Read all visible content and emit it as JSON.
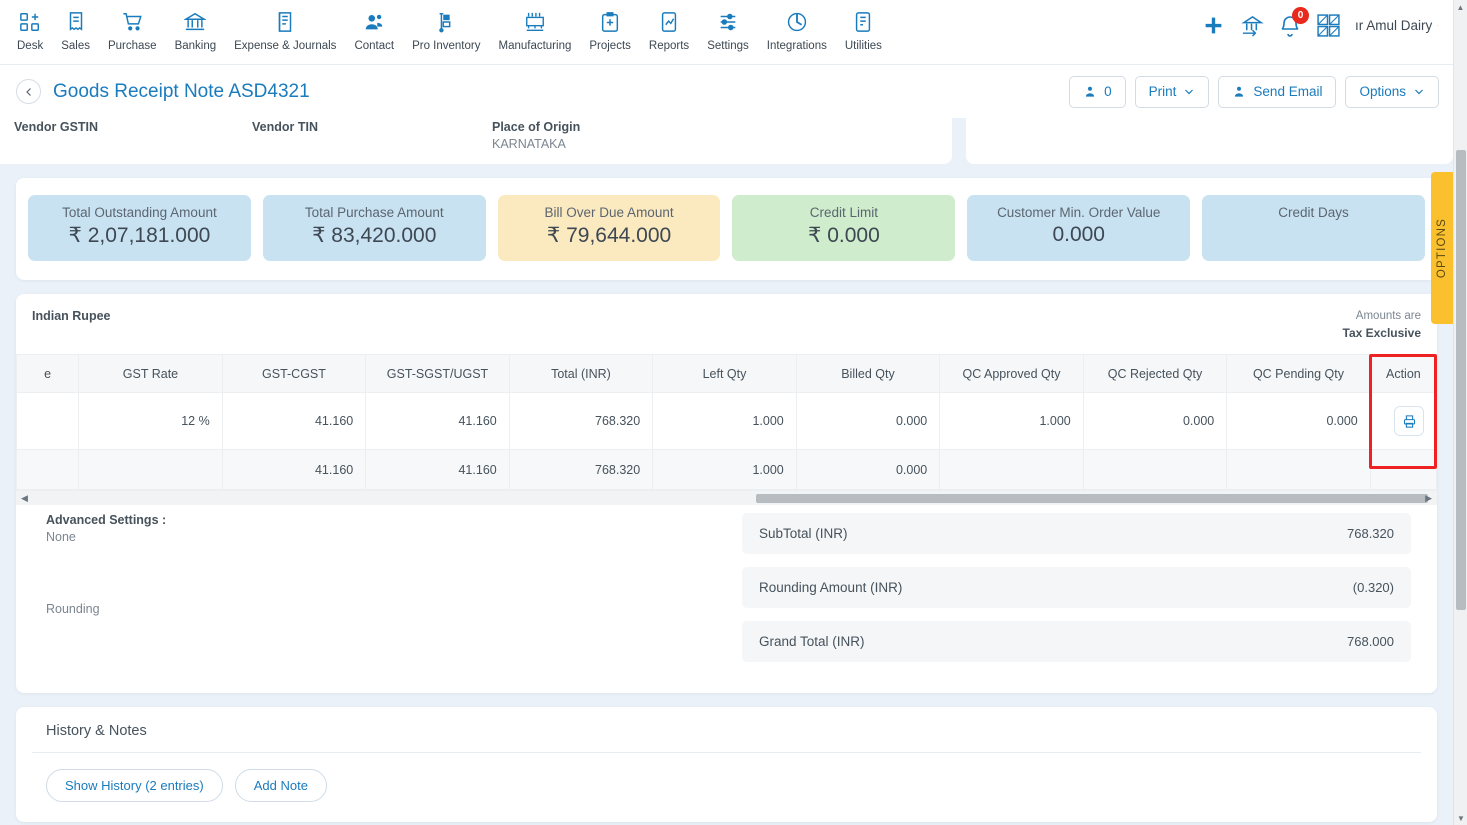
{
  "topnav": {
    "items": [
      {
        "label": "Desk",
        "icon": "desk-icon"
      },
      {
        "label": "Sales",
        "icon": "sales-icon"
      },
      {
        "label": "Purchase",
        "icon": "purchase-cart-icon"
      },
      {
        "label": "Banking",
        "icon": "bank-icon"
      },
      {
        "label": "Expense & Journals",
        "icon": "expense-journals-icon"
      },
      {
        "label": "Contact",
        "icon": "contact-icon"
      },
      {
        "label": "Pro Inventory",
        "icon": "pro-inventory-icon"
      },
      {
        "label": "Manufacturing",
        "icon": "manufacturing-icon"
      },
      {
        "label": "Projects",
        "icon": "projects-icon"
      },
      {
        "label": "Reports",
        "icon": "reports-icon"
      },
      {
        "label": "Settings",
        "icon": "settings-icon"
      },
      {
        "label": "Integrations",
        "icon": "integrations-icon"
      },
      {
        "label": "Utilities",
        "icon": "utilities-icon"
      }
    ],
    "add_icon": "plus-icon",
    "org_icon": "organization-switch-icon",
    "notification_icon": "bell-icon",
    "notification_count": "0",
    "apps_icon": "apps-grid-icon",
    "company_name": "ır Amul Dairy",
    "company_chevron": "chevron-down-icon"
  },
  "titlebar": {
    "back_icon": "chevron-left-icon",
    "title": "Goods Receipt Note ASD4321",
    "actions": [
      {
        "label": "0",
        "icon": "attachment-user-icon",
        "chevron": false
      },
      {
        "label": "Print",
        "icon": null,
        "chevron": true
      },
      {
        "label": "Send Email",
        "icon": "upload-user-icon",
        "chevron": false
      },
      {
        "label": "Options",
        "icon": null,
        "chevron": true
      }
    ]
  },
  "vendor": {
    "fields": [
      {
        "label": "Vendor GSTIN",
        "value": ""
      },
      {
        "label": "Vendor TIN",
        "value": ""
      },
      {
        "label": "Place of Origin",
        "value": "KARNATAKA"
      }
    ]
  },
  "summary_cards": [
    {
      "title": "Total Outstanding Amount",
      "value": "₹ 2,07,181.000",
      "color": "blue"
    },
    {
      "title": "Total Purchase Amount",
      "value": "₹ 83,420.000",
      "color": "blue"
    },
    {
      "title": "Bill Over Due Amount",
      "value": "₹ 79,644.000",
      "color": "amber"
    },
    {
      "title": "Credit Limit",
      "value": "₹ 0.000",
      "color": "green"
    },
    {
      "title": "Customer Min. Order Value",
      "value": "0.000",
      "color": "blue"
    },
    {
      "title": "Credit Days",
      "value": "",
      "color": "blue"
    }
  ],
  "line_table": {
    "currency_label": "Indian Rupee",
    "tax_note_line1": "Amounts are",
    "tax_note_line2": "Tax Exclusive",
    "columns": [
      "e",
      "GST Rate",
      "GST-CGST",
      "GST-SGST/UGST",
      "Total (INR)",
      "Left Qty",
      "Billed Qty",
      "QC Approved Qty",
      "QC Rejected Qty",
      "QC Pending Qty",
      "Action"
    ],
    "rows": [
      {
        "cut": "",
        "gst_rate": "12 %",
        "cgst": "41.160",
        "sgst": "41.160",
        "total": "768.320",
        "left_qty": "1.000",
        "billed_qty": "0.000",
        "qc_approved": "1.000",
        "qc_rejected": "0.000",
        "qc_pending": "0.000",
        "action_icon": "print-icon"
      }
    ],
    "totals_row": {
      "cut": "",
      "gst_rate": "",
      "cgst": "41.160",
      "sgst": "41.160",
      "total": "768.320",
      "left_qty": "1.000",
      "billed_qty": "0.000",
      "qc_approved": "",
      "qc_rejected": "",
      "qc_pending": "",
      "action": ""
    },
    "scroll_left_icon": "scroll-left-arrow",
    "scroll_right_icon": "scroll-right-arrow"
  },
  "advanced": {
    "title": "Advanced Settings :",
    "value": "None",
    "rounding_label": "Rounding"
  },
  "totals": [
    {
      "label": "SubTotal (INR)",
      "value": "768.320"
    },
    {
      "label": "Rounding Amount (INR)",
      "value": "(0.320)"
    },
    {
      "label": "Grand Total (INR)",
      "value": "768.000"
    }
  ],
  "history": {
    "title": "History & Notes",
    "show_history_label": "Show History (2 entries)",
    "add_note_label": "Add Note"
  },
  "options_tab": {
    "label": "OPTIONS"
  },
  "colors": {
    "accent": "#1a7bbd",
    "badge": "#e8291e",
    "options_tab": "#fbc02d",
    "highlight": "#ee2222",
    "card_blue": "#c9e2f2",
    "card_amber": "#fbe9c0",
    "card_green": "#cfeccd",
    "page_bg": "#eaf1f8"
  }
}
